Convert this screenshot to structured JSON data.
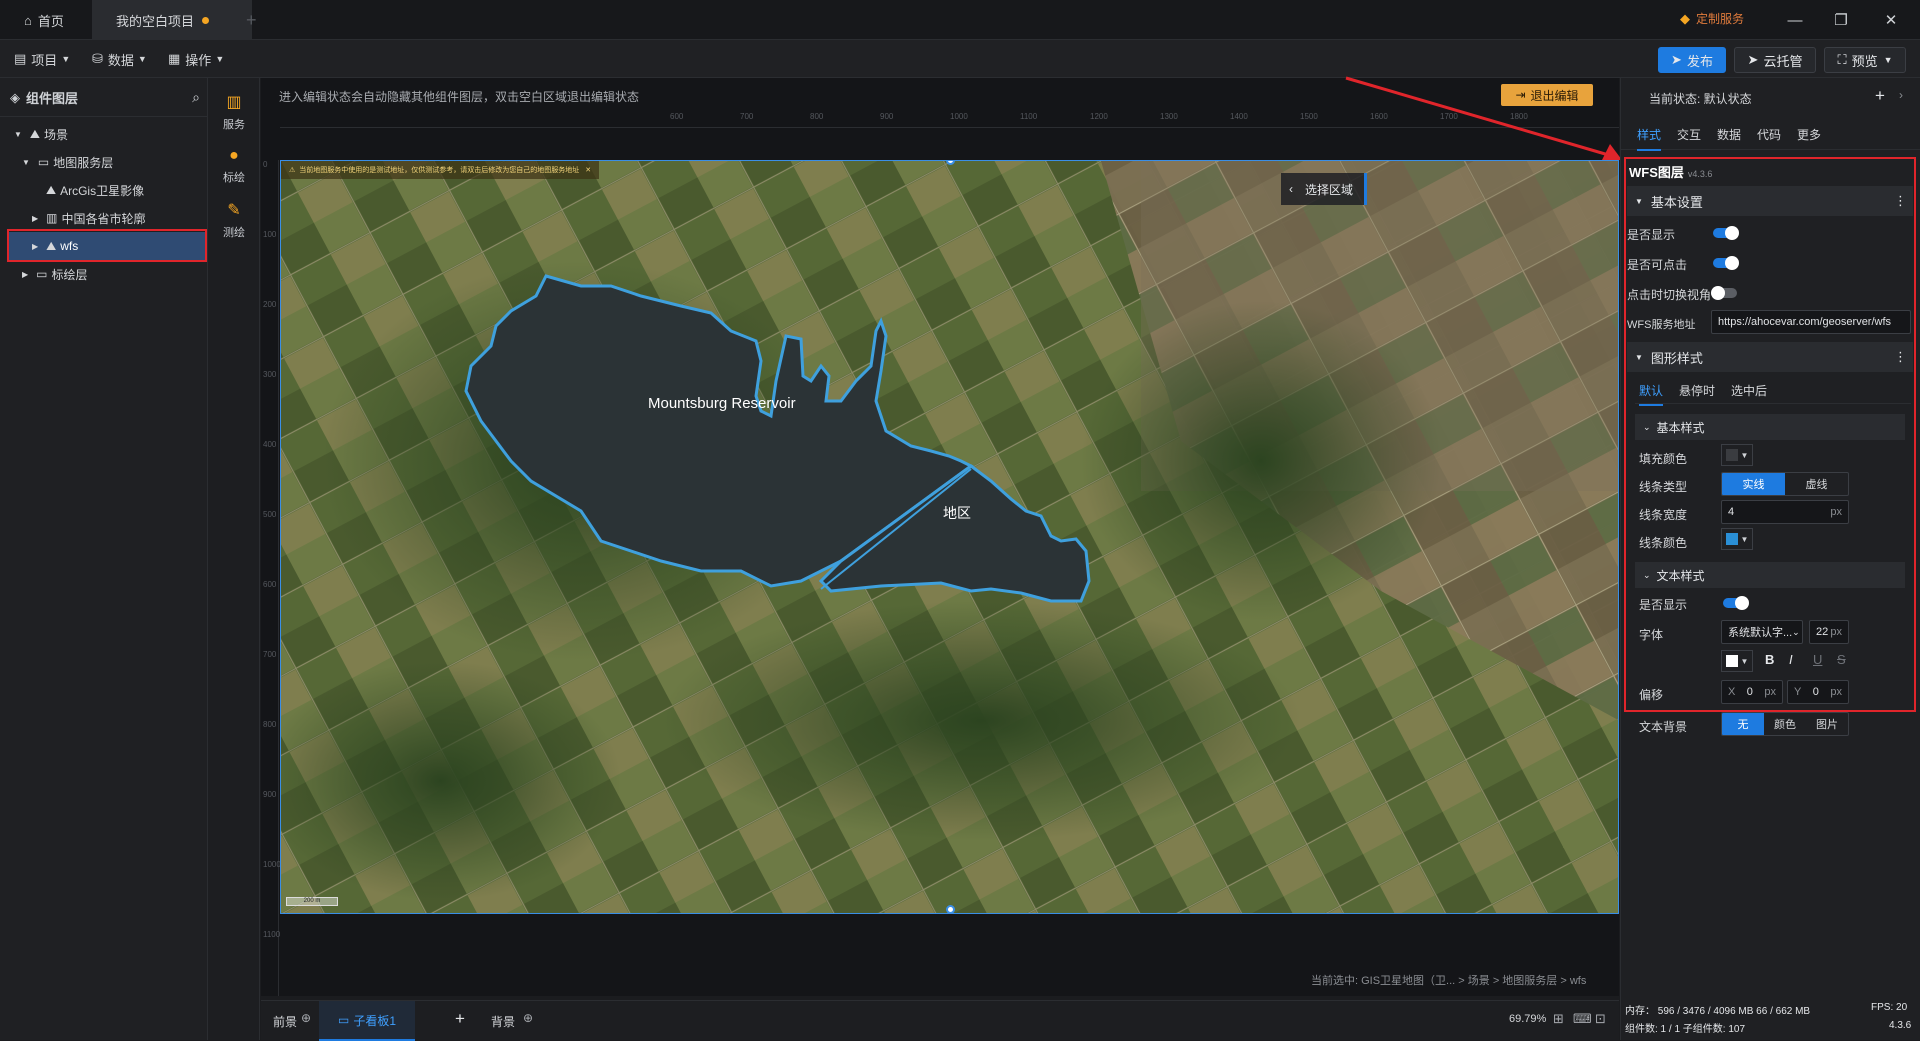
{
  "titlebar": {
    "tabs": [
      {
        "label": "首页"
      },
      {
        "label": "我的空白项目"
      }
    ],
    "custom_service": "定制服务"
  },
  "menubar": {
    "menus": [
      "项目",
      "数据",
      "操作"
    ],
    "publish": "发布",
    "cloud": "云托管",
    "preview": "预览"
  },
  "leftpanel": {
    "title": "组件图层",
    "tree": [
      {
        "label": "场景"
      },
      {
        "label": "地图服务层"
      },
      {
        "label": "ArcGis卫星影像"
      },
      {
        "label": "中国各省市轮廓"
      },
      {
        "label": "wfs"
      },
      {
        "label": "标绘层"
      }
    ]
  },
  "sidetools": [
    {
      "label": "服务",
      "icon": "map-icon"
    },
    {
      "label": "标绘",
      "icon": "pin-icon"
    },
    {
      "label": "测绘",
      "icon": "ruler-icon"
    }
  ],
  "canvas": {
    "hint": "进入编辑状态会自动隐藏其他组件图层，双击空白区域退出编辑状态",
    "exit_edit": "退出编辑",
    "select_area": "选择区域",
    "warning": "当前地图服务中使用的是测试地址，仅供测试参考，请双击后修改为您自己的地图服务地址",
    "lake_label": "Mountsburg Reservoir",
    "region_label": "地区",
    "scale": "200 m",
    "ruler_top": [
      "600",
      "700",
      "800",
      "900",
      "1000",
      "1100",
      "1200",
      "1300",
      "1400",
      "1500",
      "1600",
      "1700",
      "1800"
    ],
    "ruler_left": [
      "0",
      "100",
      "200",
      "300",
      "400",
      "500",
      "600",
      "700",
      "800",
      "900",
      "1000",
      "1100"
    ],
    "breadcrumb": "当前选中: GIS卫星地图（卫... > 场景 > 地图服务层 > wfs"
  },
  "bottombar": {
    "tabs": [
      "前景",
      "子看板1",
      "背景"
    ],
    "zoom": "69.79%"
  },
  "status": {
    "memory": "内存： 596 / 3476 / 4096 MB  66 / 662 MB",
    "fps": "FPS:  20",
    "components": "组件数: 1 / 1   子组件数: 107",
    "version": "4.3.6"
  },
  "rightpanel": {
    "state_label": "当前状态:  默认状态",
    "tabs": [
      "样式",
      "交互",
      "数据",
      "代码",
      "更多"
    ],
    "layer_title": "WFS图层",
    "layer_version": "v4.3.6",
    "basic_section": "基本设置",
    "show": "是否显示",
    "clickable": "是否可点击",
    "click_switch": "点击时切换视角",
    "wfs_url_label": "WFS服务地址",
    "wfs_url": "https://ahocevar.com/geoserver/wfs",
    "shape_section": "图形样式",
    "state_tabs": [
      "默认",
      "悬停时",
      "选中后"
    ],
    "base_style": "基本样式",
    "fill_color": "填充颜色",
    "line_type": "线条类型",
    "line_solid": "实线",
    "line_dashed": "虚线",
    "line_width": "线条宽度",
    "line_width_value": "4",
    "px": "px",
    "line_color": "线条颜色",
    "text_style": "文本样式",
    "text_show": "是否显示",
    "font": "字体",
    "font_value": "系统默认字...",
    "font_size": "22",
    "offset": "偏移",
    "offset_x_label": "X",
    "offset_x": "0",
    "offset_y_label": "Y",
    "offset_y": "0",
    "text_bg": "文本背景",
    "bg_none": "无",
    "bg_color": "颜色",
    "bg_image": "图片",
    "bold": "B",
    "italic": "I",
    "underline": "U",
    "strike": "S"
  },
  "colors": {
    "accent": "#1e7be0",
    "highlight": "#e0252b",
    "line_color": "#2a8fd6",
    "exit_btn": "#e8a33c"
  }
}
